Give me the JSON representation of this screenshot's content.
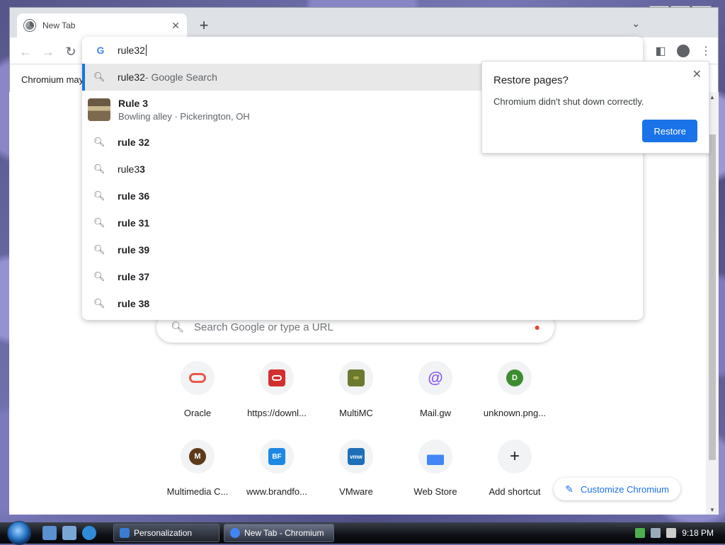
{
  "tab": {
    "title": "New Tab"
  },
  "infobar": {
    "text": "Chromium may"
  },
  "omnibox": {
    "input_value": "rule32",
    "suggestions": [
      {
        "main": "rule32",
        "suffix": " - Google Search"
      },
      {
        "title": "Rule 3",
        "subtitle": "Bowling alley · Pickerington, OH"
      },
      {
        "prefix": "",
        "bold": "rule 32"
      },
      {
        "prefix": "rule3",
        "bold": "3"
      },
      {
        "prefix": "",
        "bold": "rule 36"
      },
      {
        "prefix": "",
        "bold": "rule 31"
      },
      {
        "prefix": "",
        "bold": "rule 39"
      },
      {
        "prefix": "",
        "bold": "rule 37"
      },
      {
        "prefix": "",
        "bold": "rule 38"
      }
    ]
  },
  "restore_bubble": {
    "title": "Restore pages?",
    "message": "Chromium didn't shut down correctly.",
    "button": "Restore"
  },
  "ntp": {
    "search_placeholder": "Search Google or type a URL",
    "shortcuts": [
      {
        "label": "Oracle",
        "icon": "oracle-icon",
        "color": "#e8584a"
      },
      {
        "label": "https://downl...",
        "icon": "oracle-red-square-icon",
        "color": "#d32f2f"
      },
      {
        "label": "MultiMC",
        "icon": "multimc-icon",
        "color": "#6b7a2f"
      },
      {
        "label": "Mail.gw",
        "icon": "at-sign-icon",
        "color": "#8a5cf6"
      },
      {
        "label": "unknown.png...",
        "icon": "letter-d-icon",
        "letter": "D",
        "color": "#3c8d2f"
      },
      {
        "label": "Multimedia C...",
        "icon": "letter-m-icon",
        "letter": "M",
        "color": "#5d3a1a"
      },
      {
        "label": "www.brandfo...",
        "icon": "brandfolder-icon",
        "letter": "BF",
        "color": "#1e88e5"
      },
      {
        "label": "VMware",
        "icon": "vmware-icon",
        "letter": "vmw",
        "color": "#1d6fb8"
      },
      {
        "label": "Web Store",
        "icon": "webstore-icon",
        "color": "#4285f4"
      },
      {
        "label": "Add shortcut",
        "icon": "plus-icon",
        "letter": "+",
        "color": "#202124"
      }
    ],
    "customize_label": "Customize Chromium"
  },
  "taskbar": {
    "items": [
      {
        "label": "Personalization"
      },
      {
        "label": "New Tab - Chromium"
      }
    ],
    "clock": "9:18 PM"
  }
}
